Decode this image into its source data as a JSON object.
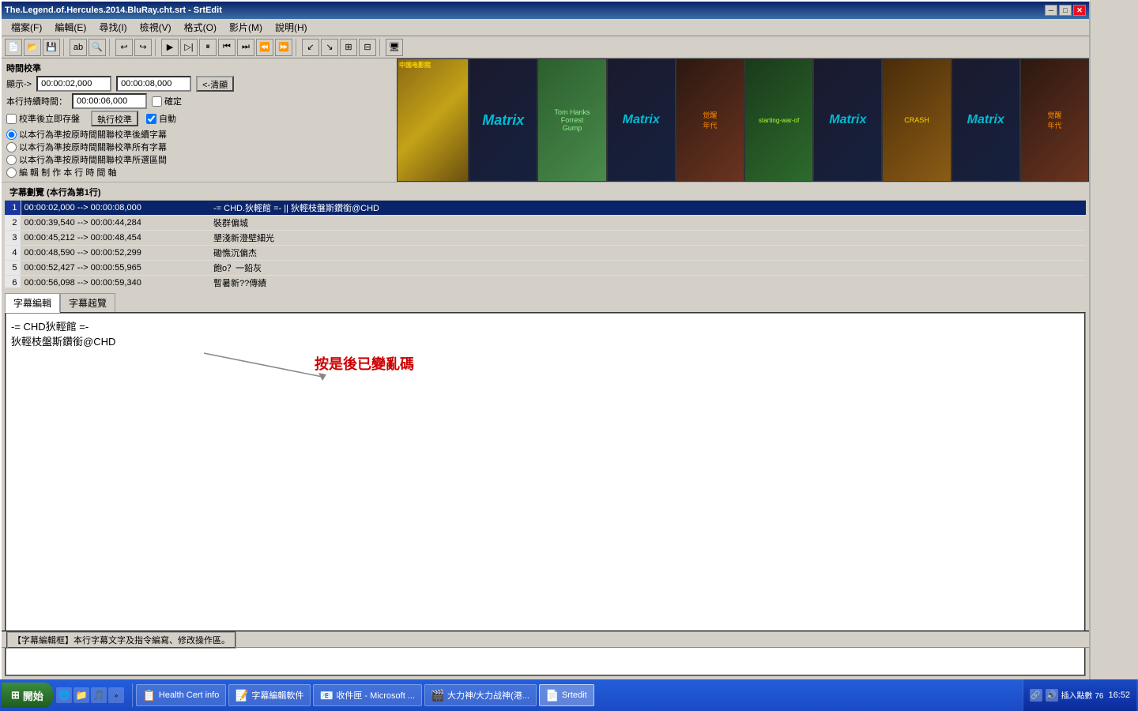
{
  "window": {
    "title": "The.Legend.of.Hercules.2014.BluRay.cht.srt - SrtEdit",
    "controls": {
      "minimize": "─",
      "maximize": "□",
      "close": "✕"
    }
  },
  "menu": {
    "items": [
      {
        "label": "檔案(F)"
      },
      {
        "label": "編輯(E)"
      },
      {
        "label": "尋找(I)"
      },
      {
        "label": "檢視(V)"
      },
      {
        "label": "格式(O)"
      },
      {
        "label": "影片(M)"
      },
      {
        "label": "說明(H)"
      }
    ]
  },
  "time_controls": {
    "label": "時間校準",
    "display_label": "顯示->",
    "time1": "00:00:02,000",
    "time2": "00:00:08,000",
    "clear_btn": "<-清顯",
    "duration_label": "本行持續時間：",
    "duration": "00:00:06,000",
    "confirm_btn": "確定",
    "save_label": "校準後立即存盤",
    "exec_label": "執行校準",
    "auto_label": "自動"
  },
  "radio_options": [
    "以本行為準按原時間關聯校準後續字幕",
    "以本行為準按原時間關聯校準所有字幕",
    "以本行為準按原時間關聯校準所選區間",
    "編 輯 制 作 本 行 時 間 軸"
  ],
  "subtitle_header": "字幕劃覽 (本行為第1行)",
  "subtitle_rows": [
    {
      "num": "1",
      "time": "00:00:02,000  -->  00:00:08,000",
      "text": "-= CHD.狄輕館 =- || 狄輕枝盤斯鑽銜@CHD",
      "selected": true
    },
    {
      "num": "2",
      "time": "00:00:39,540  -->  00:00:44,284",
      "text": "裝群偏城"
    },
    {
      "num": "3",
      "time": "00:00:45,212  -->  00:00:48,454",
      "text": "墾淺新澄壁細光"
    },
    {
      "num": "4",
      "time": "00:00:48,590  -->  00:00:52,299",
      "text": "磡憔沉偏杰"
    },
    {
      "num": "5",
      "time": "00:00:52,427  -->  00:00:55,965",
      "text": "飽ο？一鉛灰"
    },
    {
      "num": "6",
      "time": "00:00:56,098  -->  00:00:59,340",
      "text": "暫暑新??傳績"
    }
  ],
  "edit_tabs": [
    {
      "label": "字幕編輯",
      "active": true
    },
    {
      "label": "字幕趤覽"
    }
  ],
  "edit_content": {
    "line1": "-= CHD狄輕館 =-",
    "line2": "狄輕枝盤斯鑽銜@CHD"
  },
  "annotation": "按是後已變亂碼",
  "status_text": "【字幕編輯框】本行字幕文字及指令編寫、修改操作區。",
  "taskbar": {
    "start_label": "開始",
    "items": [
      {
        "label": "Health Cert info",
        "icon": "📋"
      },
      {
        "label": "字幕編輯軟件",
        "icon": "📝"
      },
      {
        "label": "收件匣 - Microsoft ...",
        "icon": "📧"
      },
      {
        "label": "大力神/大力战神(港...",
        "icon": "🎬"
      },
      {
        "label": "Srtedit",
        "icon": "📄"
      }
    ],
    "clock": "16:52",
    "ime": "插入點數 76"
  },
  "thumbs": [
    {
      "id": 1,
      "class": "thumb1",
      "text": "🎬"
    },
    {
      "id": 2,
      "class": "thumb2",
      "text": "🎬"
    },
    {
      "id": 3,
      "class": "thumb3",
      "text": "🎬"
    },
    {
      "id": 4,
      "class": "thumb4",
      "text": "🎬"
    },
    {
      "id": 5,
      "class": "thumb5",
      "text": "🎬"
    },
    {
      "id": 6,
      "class": "thumb6",
      "text": "🎬"
    },
    {
      "id": 7,
      "class": "thumb7",
      "text": "🎬"
    },
    {
      "id": 8,
      "class": "thumb8",
      "text": "🎬"
    },
    {
      "id": 9,
      "class": "thumb9",
      "text": "🎬"
    },
    {
      "id": 10,
      "class": "thumb10",
      "text": "🎬"
    }
  ]
}
